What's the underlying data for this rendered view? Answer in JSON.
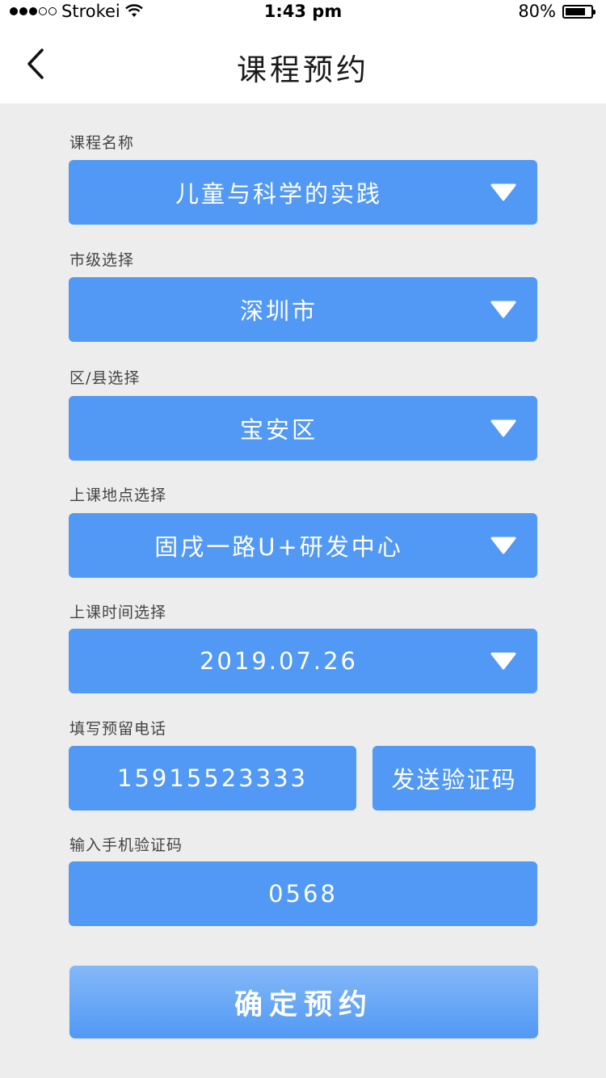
{
  "status_bar": {
    "carrier": "Strokei",
    "time": "1:43 pm",
    "battery": "80%",
    "battery_level": 0.8,
    "icons": [
      "signal-dots-icon",
      "wifi-icon",
      "battery-icon"
    ]
  },
  "nav": {
    "title": "课程预约",
    "back_icon": "chevron-left-icon"
  },
  "form": {
    "course": {
      "label": "课程名称",
      "value": "儿童与科学的实践"
    },
    "city": {
      "label": "市级选择",
      "value": "深圳市"
    },
    "district": {
      "label": "区/县选择",
      "value": "宝安区"
    },
    "location": {
      "label": "上课地点选择",
      "value": "固戌一路U+研发中心"
    },
    "time": {
      "label": "上课时间选择",
      "value": "2019.07.26"
    },
    "phone": {
      "label": "填写预留电话",
      "value": "15915523333",
      "send_code_label": "发送验证码"
    },
    "code": {
      "label": "输入手机验证码",
      "value": "0568"
    },
    "submit_label": "确定预约"
  },
  "colors": {
    "accent": "#5199f4",
    "accent_light": "#84b8f8",
    "background": "#ededed"
  }
}
